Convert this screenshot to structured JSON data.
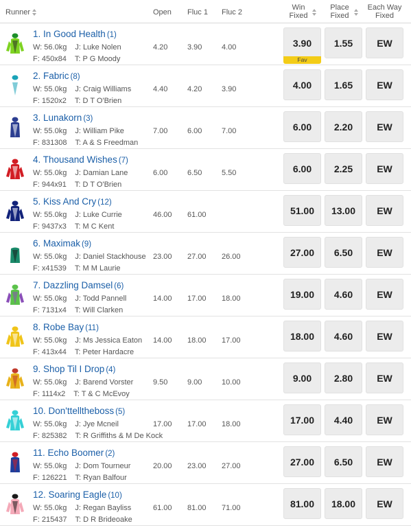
{
  "headers": {
    "runner": "Runner",
    "open": "Open",
    "fluc1": "Fluc 1",
    "fluc2": "Fluc 2",
    "win_l1": "Win",
    "win_l2": "Fixed",
    "place_l1": "Place",
    "place_l2": "Fixed",
    "ew_l1": "Each Way",
    "ew_l2": "Fixed"
  },
  "fav_label": "Fav",
  "runners": [
    {
      "name": "1. In Good Health",
      "barrier": "(1)",
      "weight": "W: 56.0kg",
      "jockey": "J: Luke Nolen",
      "form": "F: 450x84",
      "trainer": "T: P G Moody",
      "open": "4.20",
      "fluc1": "3.90",
      "fluc2": "4.00",
      "win": "3.90",
      "place": "1.55",
      "ew": "EW",
      "fav": true,
      "silk": {
        "body": "#7ed321",
        "sleeve": "#7ed321",
        "cap": "#1d8f2a",
        "pattern": "#2a2a2a"
      }
    },
    {
      "name": "2. Fabric",
      "barrier": "(8)",
      "weight": "W: 55.0kg",
      "jockey": "J: Craig Williams",
      "form": "F: 1520x2",
      "trainer": "T: D T O'Brien",
      "open": "4.40",
      "fluc1": "4.20",
      "fluc2": "3.90",
      "win": "4.00",
      "place": "1.65",
      "ew": "EW",
      "fav": false,
      "silk": {
        "body": "#ffffff",
        "sleeve": "#ffffff",
        "cap": "#1aa3b8",
        "pattern": "#1aa3b8"
      }
    },
    {
      "name": "3. Lunakorn",
      "barrier": "(3)",
      "weight": "W: 55.0kg",
      "jockey": "J: William Pike",
      "form": "F: 831308",
      "trainer": "T: A & S Freedman",
      "open": "7.00",
      "fluc1": "6.00",
      "fluc2": "7.00",
      "win": "6.00",
      "place": "2.20",
      "ew": "EW",
      "fav": false,
      "silk": {
        "body": "#2c3e91",
        "sleeve": "#ffffff",
        "cap": "#2c3e91",
        "pattern": "#ffffff"
      }
    },
    {
      "name": "4. Thousand Wishes",
      "barrier": "(7)",
      "weight": "W: 55.0kg",
      "jockey": "J: Damian Lane",
      "form": "F: 944x91",
      "trainer": "T: D T O'Brien",
      "open": "6.00",
      "fluc1": "6.50",
      "fluc2": "5.50",
      "win": "6.00",
      "place": "2.25",
      "ew": "EW",
      "fav": false,
      "silk": {
        "body": "#d21d24",
        "sleeve": "#d21d24",
        "cap": "#d21d24",
        "pattern": "#ffffff"
      }
    },
    {
      "name": "5. Kiss And Cry",
      "barrier": "(12)",
      "weight": "W: 55.0kg",
      "jockey": "J: Luke Currie",
      "form": "F: 9437x3",
      "trainer": "T: M C Kent",
      "open": "46.00",
      "fluc1": "61.00",
      "fluc2": "",
      "win": "51.00",
      "place": "13.00",
      "ew": "EW",
      "fav": false,
      "silk": {
        "body": "#12237a",
        "sleeve": "#12237a",
        "cap": "#12237a",
        "pattern": "#ffffff"
      }
    },
    {
      "name": "6. Maximak",
      "barrier": "(9)",
      "weight": "W: 55.0kg",
      "jockey": "J: Daniel Stackhouse",
      "form": "F: x41539",
      "trainer": "T: M M Laurie",
      "open": "23.00",
      "fluc1": "27.00",
      "fluc2": "26.00",
      "win": "27.00",
      "place": "6.50",
      "ew": "EW",
      "fav": false,
      "silk": {
        "body": "#1a8a6a",
        "sleeve": "#ffffff",
        "cap": "#ffffff",
        "pattern": "#1a1a1a"
      }
    },
    {
      "name": "7. Dazzling Damsel",
      "barrier": "(6)",
      "weight": "W: 55.0kg",
      "jockey": "J: Todd Pannell",
      "form": "F: 7131x4",
      "trainer": "T: Will Clarken",
      "open": "14.00",
      "fluc1": "17.00",
      "fluc2": "18.00",
      "win": "19.00",
      "place": "4.60",
      "ew": "EW",
      "fav": false,
      "silk": {
        "body": "#5bc24a",
        "sleeve": "#8a4fb8",
        "cap": "#5bc24a",
        "pattern": "#8a4fb8"
      }
    },
    {
      "name": "8. Robe Bay",
      "barrier": "(11)",
      "weight": "W: 55.0kg",
      "jockey": "J: Ms Jessica Eaton",
      "form": "F: 413x44",
      "trainer": "T: Peter Hardacre",
      "open": "14.00",
      "fluc1": "18.00",
      "fluc2": "17.00",
      "win": "18.00",
      "place": "4.60",
      "ew": "EW",
      "fav": false,
      "silk": {
        "body": "#f0c419",
        "sleeve": "#f0c419",
        "cap": "#f0c419",
        "pattern": "#ffffff"
      }
    },
    {
      "name": "9. Shop Til I Drop",
      "barrier": "(4)",
      "weight": "W: 55.0kg",
      "jockey": "J: Barend Vorster",
      "form": "F: 1114x2",
      "trainer": "T: T & C McEvoy",
      "open": "9.50",
      "fluc1": "9.00",
      "fluc2": "10.00",
      "win": "9.00",
      "place": "2.80",
      "ew": "EW",
      "fav": false,
      "silk": {
        "body": "#e8b21a",
        "sleeve": "#e8b21a",
        "cap": "#c0392b",
        "pattern": "#c0392b"
      }
    },
    {
      "name": "10. Don'ttelltheboss",
      "barrier": "(5)",
      "weight": "W: 55.0kg",
      "jockey": "J: Jye Mcneil",
      "form": "F: 825382",
      "trainer": "T: R Griffiths & M De Kock",
      "open": "17.00",
      "fluc1": "17.00",
      "fluc2": "18.00",
      "win": "17.00",
      "place": "4.40",
      "ew": "EW",
      "fav": false,
      "silk": {
        "body": "#35d0d6",
        "sleeve": "#35d0d6",
        "cap": "#35d0d6",
        "pattern": "#ffffff"
      }
    },
    {
      "name": "11. Echo Boomer",
      "barrier": "(2)",
      "weight": "W: 55.0kg",
      "jockey": "J: Dom Tourneur",
      "form": "F: 126221",
      "trainer": "T: Ryan Balfour",
      "open": "20.00",
      "fluc1": "23.00",
      "fluc2": "27.00",
      "win": "27.00",
      "place": "6.50",
      "ew": "EW",
      "fav": false,
      "silk": {
        "body": "#1f3e9c",
        "sleeve": "#ffffff",
        "cap": "#d21d24",
        "pattern": "#d21d24"
      }
    },
    {
      "name": "12. Soaring Eagle",
      "barrier": "(10)",
      "weight": "W: 55.0kg",
      "jockey": "J: Regan Bayliss",
      "form": "F: 215437",
      "trainer": "T: D R Brideoake",
      "open": "61.00",
      "fluc1": "81.00",
      "fluc2": "71.00",
      "win": "81.00",
      "place": "18.00",
      "ew": "EW",
      "fav": false,
      "silk": {
        "body": "#f4a9b8",
        "sleeve": "#f4a9b8",
        "cap": "#1a1a1a",
        "pattern": "#1a1a1a"
      }
    }
  ]
}
